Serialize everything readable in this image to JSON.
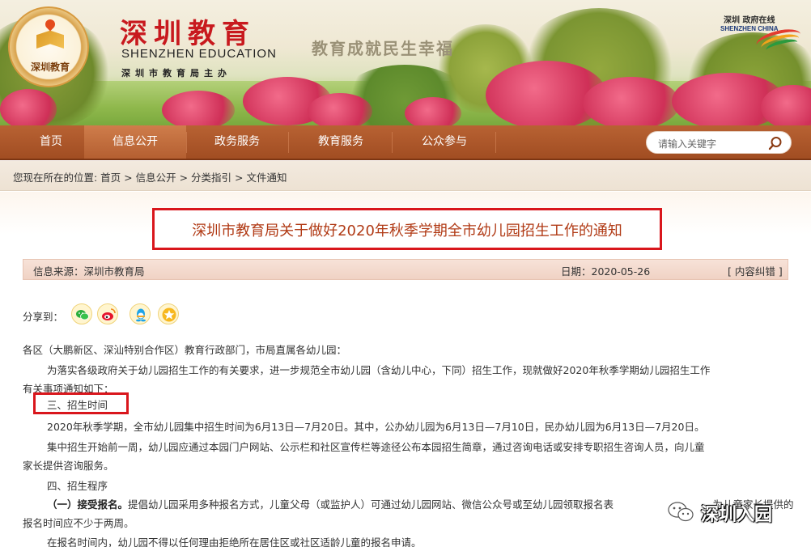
{
  "banner": {
    "logo_text": "深圳教育",
    "site_title": "深圳教育",
    "site_subtitle": "SHENZHEN EDUCATION",
    "site_host": "深圳市教育局主办",
    "slogan": "教育成就民生幸福",
    "partner_logo_cn": "深圳 政府在线",
    "partner_logo_en": "SHENZHEN CHINA"
  },
  "nav": {
    "items": [
      {
        "label": "首页"
      },
      {
        "label": "信息公开"
      },
      {
        "label": "政务服务"
      },
      {
        "label": "教育服务"
      },
      {
        "label": "公众参与"
      }
    ],
    "active_index": 1,
    "search_placeholder": "请输入关键字"
  },
  "breadcrumb": "您现在所在的位置: 首页 > 信息公开 > 分类指引 > 文件通知",
  "article": {
    "title": "深圳市教育局关于做好2020年秋季学期全市幼儿园招生工作的通知",
    "source": "信息来源：深圳市教育局",
    "date": "日期：2020-05-26",
    "correction": "[ 内容纠错 ]",
    "share_label": "分享到：",
    "share_icons": [
      "wechat-icon",
      "weibo-icon",
      "qq-icon",
      "star-icon"
    ],
    "lines": [
      "各区（大鹏新区、深汕特别合作区）教育行政部门，市局直属各幼儿园：",
      "为落实各级政府关于幼儿园招生工作的有关要求，进一步规范全市幼儿园（含幼儿中心，下同）招生工作，现就做好2020年秋季学期幼儿园招生工作",
      "有关事项通知如下：",
      "三、招生时间",
      "2020年秋季学期，全市幼儿园集中招生时间为6月13日—7月20日。其中，公办幼儿园为6月13日—7月10日，民办幼儿园为6月13日—7月20日。",
      "集中招生开始前一周，幼儿园应通过本园门户网站、公示栏和社区宣传栏等途径公布本园招生简章，通过咨询电话或安排专职招生咨询人员，向儿童",
      "家长提供咨询服务。",
      "四、招生程序",
      "（一）接受报名。",
      "提倡幼儿园采用多种报名方式，儿童父母（或监护人）可通过幼儿园网站、微信公众号或至幼儿园领取报名表",
      "。为儿童家长提供的",
      "报名时间应不少于两周。",
      "在报名时间内，幼儿园不得以任何理由拒绝所在居住区或社区适龄儿童的报名申请。"
    ]
  },
  "watermark": "深圳入园",
  "colors": {
    "nav_bg": "#a14d22",
    "highlight_border": "#d9161c",
    "title_color": "#b13b16",
    "brand_red": "#c8191e"
  }
}
